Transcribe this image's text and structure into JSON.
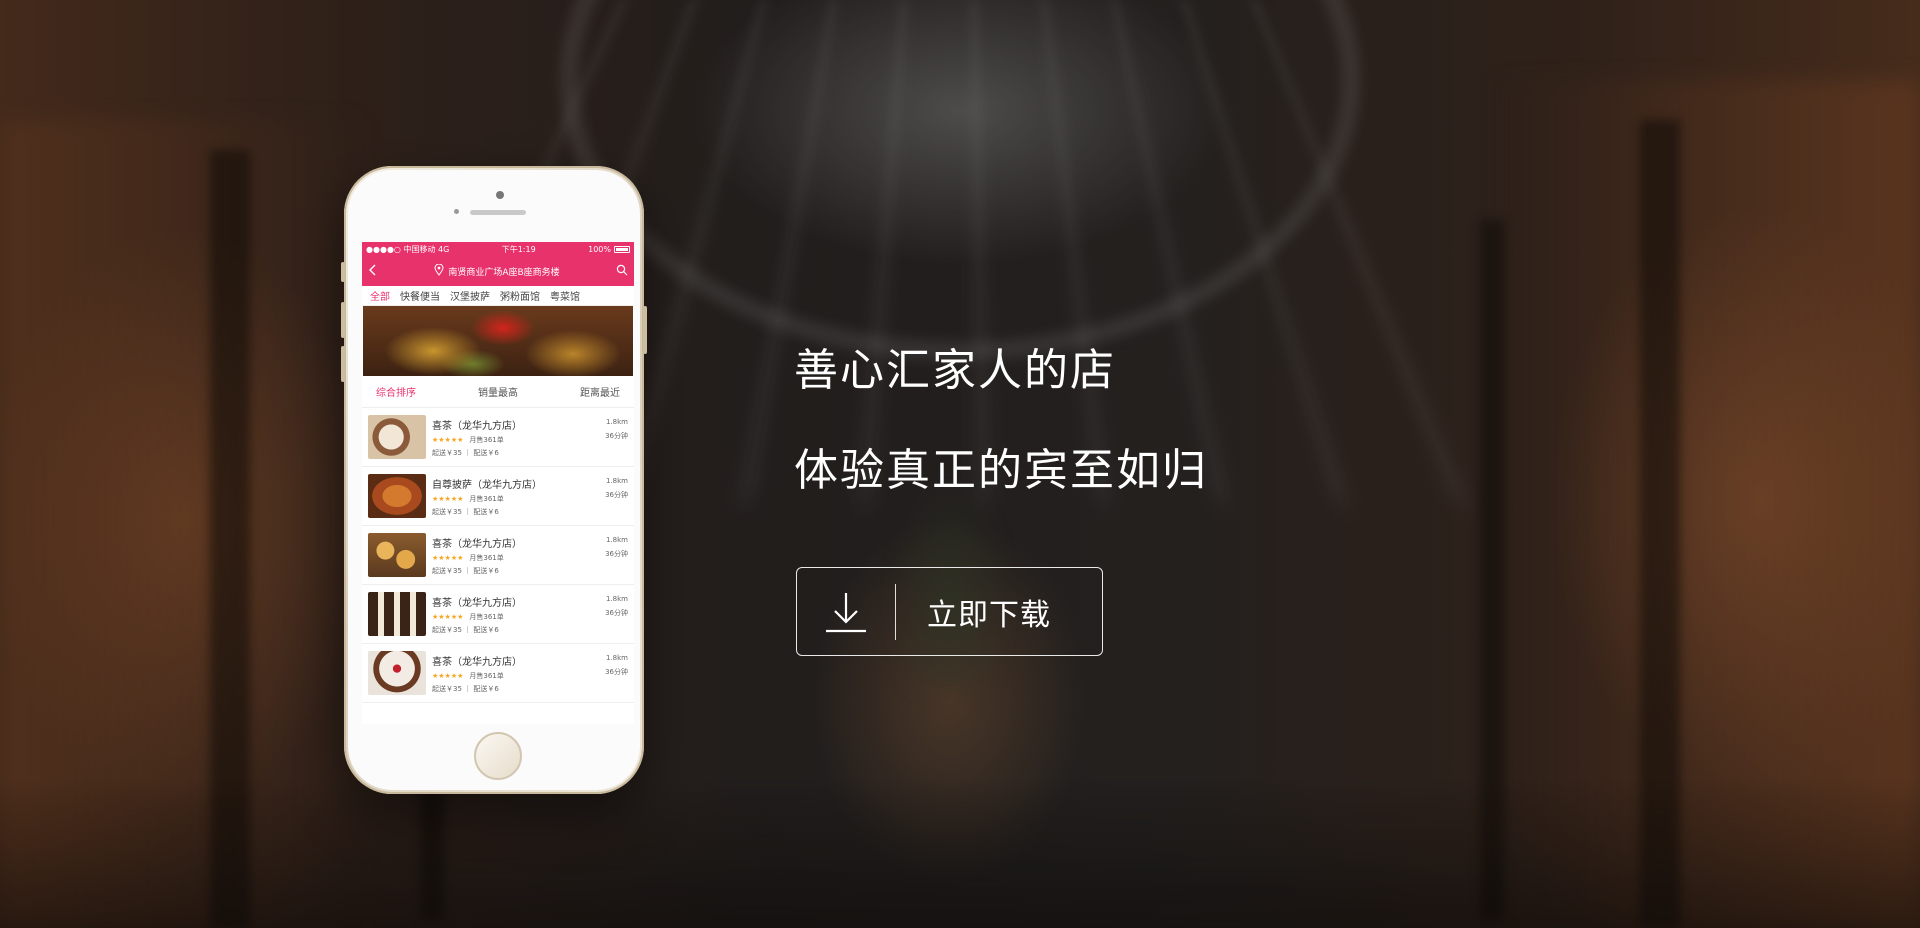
{
  "colors": {
    "accent": "#e8326b",
    "star": "#f5a623",
    "text_light": "#ffffff"
  },
  "phone": {
    "status_bar": {
      "carrier": "●●●●○ 中国移动 4G",
      "time": "下午1:19",
      "battery": "100%"
    },
    "nav": {
      "back_icon": "chevron-left-icon",
      "location_icon": "map-pin-icon",
      "location": "南贤商业广场A座B座商务楼",
      "search_icon": "search-icon"
    },
    "categories": [
      "全部",
      "快餐便当",
      "汉堡披萨",
      "粥粉面馆",
      "粤菜馆"
    ],
    "sort_tabs": [
      "综合排序",
      "销量最高",
      "距离最近"
    ],
    "shops": [
      {
        "name": "喜茶（龙华九方店）",
        "stars": "★★★★★",
        "monthly": "月售361单",
        "fee": "起送￥35 ｜ 配送￥6",
        "distance": "1.8km",
        "time": "36分钟"
      },
      {
        "name": "自尊披萨（龙华九方店）",
        "stars": "★★★★★",
        "monthly": "月售361单",
        "fee": "起送￥35 ｜ 配送￥6",
        "distance": "1.8km",
        "time": "36分钟"
      },
      {
        "name": "喜茶（龙华九方店）",
        "stars": "★★★★★",
        "monthly": "月售361单",
        "fee": "起送￥35 ｜ 配送￥6",
        "distance": "1.8km",
        "time": "36分钟"
      },
      {
        "name": "喜茶（龙华九方店）",
        "stars": "★★★★★",
        "monthly": "月售361单",
        "fee": "起送￥35 ｜ 配送￥6",
        "distance": "1.8km",
        "time": "36分钟"
      },
      {
        "name": "喜茶（龙华九方店）",
        "stars": "★★★★★",
        "monthly": "月售361单",
        "fee": "起送￥35 ｜ 配送￥6",
        "distance": "1.8km",
        "time": "36分钟"
      }
    ]
  },
  "hero": {
    "line1": "善心汇家人的店",
    "line2": "体验真正的宾至如归",
    "download_label": "立即下载",
    "download_icon": "download-icon"
  }
}
